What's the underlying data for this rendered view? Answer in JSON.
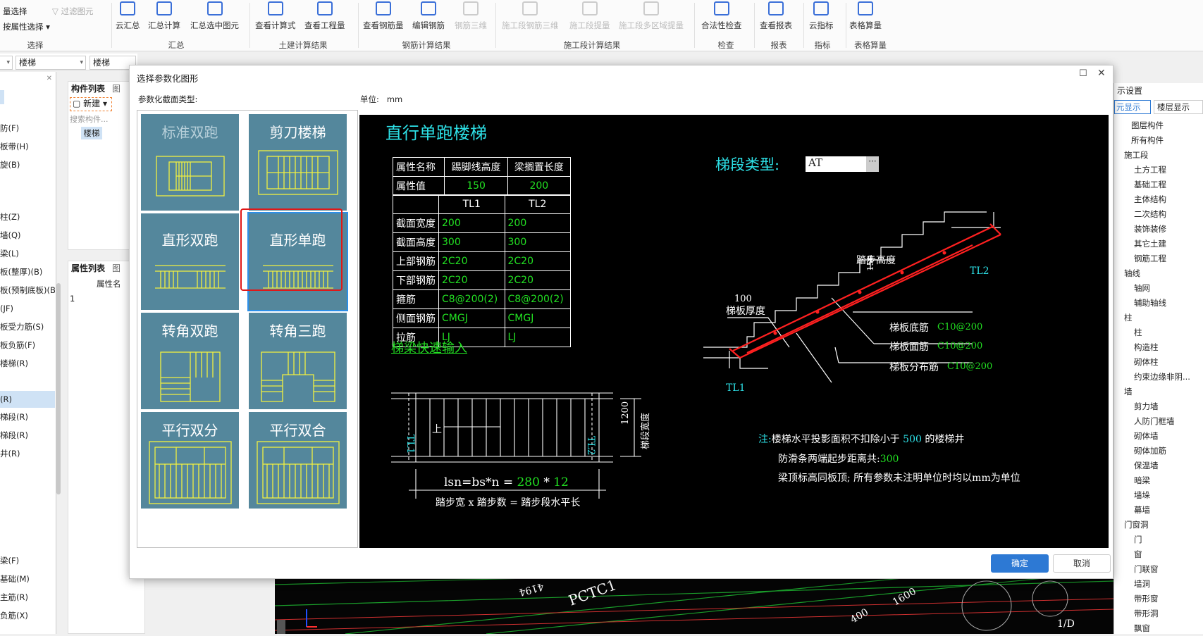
{
  "ribbon": {
    "select_group": {
      "label": "选择",
      "batch_select": "量选择",
      "filter": "过滤图元",
      "prop_select": "按属性选择"
    },
    "summary_group": {
      "label": "汇总",
      "cloud_summary": "云汇总",
      "summary_calc": "汇总计算",
      "summary_selected": "汇总选中图元"
    },
    "civil_group": {
      "label": "土建计算结果",
      "view_formula": "查看计算式",
      "view_quantity": "查看工程量"
    },
    "rebar_group": {
      "label": "钢筋计算结果",
      "view_rebar": "查看钢筋量",
      "edit_rebar": "编辑钢筋",
      "rebar_3d": "钢筋三维"
    },
    "construction_group": {
      "label": "施工段计算结果",
      "seg_rebar_3d": "施工段钢筋三维",
      "seg_extract": "施工段提量",
      "seg_multi_extract": "施工段多区域提量"
    },
    "check_group": {
      "label": "检查",
      "legality_check": "合法性检查"
    },
    "report_group": {
      "label": "报表",
      "view_report": "查看报表"
    },
    "index_group": {
      "label": "指标",
      "cloud_index": "云指标"
    },
    "table_group": {
      "label": "表格算量",
      "table_calc": "表格算量"
    }
  },
  "filterbar": {
    "combo1": "楼梯",
    "combo2": "楼梯"
  },
  "nav_items": [
    "防(F)",
    "板带(H)",
    "旋(B)",
    "柱(Z)",
    "墙(Q)",
    "梁(L)",
    "板(整厚)(B)",
    "板(预制底板)(B)",
    "(JF)",
    "板受力筋(S)",
    "板负筋(F)",
    "楼梯(R)",
    "(R)",
    "梯段(R)",
    "梯段(R)",
    "井(R)",
    "梁(F)",
    "基础(M)",
    "主筋(R)",
    "负筋(X)"
  ],
  "component_list": {
    "tab1": "构件列表",
    "tab2": "图",
    "new_button": "新建",
    "search_placeholder": "搜索构件...",
    "item": "楼梯"
  },
  "property_list": {
    "tab1": "属性列表",
    "tab2": "图",
    "col_name": "属性名",
    "row1": "1"
  },
  "right_panel": {
    "header": "示设置",
    "tab1": "元显示",
    "tab2": "楼层显示",
    "items": [
      "图层构件",
      "所有构件",
      "施工段",
      "土方工程",
      "基础工程",
      "主体结构",
      "二次结构",
      "装饰装修",
      "其它土建",
      "钢筋工程",
      "轴线",
      "轴网",
      "辅助轴线",
      "柱",
      "柱",
      "构造柱",
      "砌体柱",
      "约束边缘非阴...",
      "墙",
      "剪力墙",
      "人防门框墙",
      "砌体墙",
      "砌体加筋",
      "保温墙",
      "暗梁",
      "墙垛",
      "幕墙",
      "门窗洞",
      "门",
      "窗",
      "门联窗",
      "墙洞",
      "带形窗",
      "带形洞",
      "飘窗"
    ]
  },
  "viewport_labels": {
    "lbl1": "PCTC1",
    "lbl2": "400",
    "lbl3": "1600",
    "lbl4": "1/D",
    "lbl5": "4194"
  },
  "dialog": {
    "title": "选择参数化图形",
    "section_type_label": "参数化截面类型:",
    "unit_label": "单位:",
    "unit_value": "mm",
    "shapes": [
      "标准双跑",
      "剪刀楼梯",
      "直形双跑",
      "直形单跑",
      "转角双跑",
      "转角三跑",
      "平行双分",
      "平行双合"
    ],
    "selected_shape": "直形单跑",
    "ok_button": "确定",
    "cancel_button": "取消"
  },
  "cad": {
    "title": "直行单跑楼梯",
    "attr_table": {
      "h1": "属性名称",
      "h2": "踢脚线高度",
      "h3": "梁搁置长度",
      "r1": "属性值",
      "v1": "150",
      "v2": "200"
    },
    "beam_table": {
      "col1": "TL1",
      "col2": "TL2",
      "rows": [
        {
          "name": "截面宽度",
          "tl1": "200",
          "tl2": "200"
        },
        {
          "name": "截面高度",
          "tl1": "300",
          "tl2": "300"
        },
        {
          "name": "上部钢筋",
          "tl1": "2C20",
          "tl2": "2C20"
        },
        {
          "name": "下部钢筋",
          "tl1": "2C20",
          "tl2": "2C20"
        },
        {
          "name": "箍筋",
          "tl1": "C8@200(2)",
          "tl2": "C8@200(2)"
        },
        {
          "name": "侧面钢筋",
          "tl1": "CMGJ",
          "tl2": "CMGJ"
        },
        {
          "name": "拉筋",
          "tl1": "LJ",
          "tl2": "LJ"
        }
      ]
    },
    "quick_input": "梯梁快速输入",
    "segment_type_label": "梯段类型:",
    "segment_type_value": "AT",
    "step_height_label": "踏步高度",
    "step_height_value": "150",
    "thickness_value": "100",
    "thickness_label": "梯板厚度",
    "tl1": "TL1",
    "tl2": "TL2",
    "bottom_rebar_label": "梯板底筋",
    "bottom_rebar_value": "C10@200",
    "top_rebar_label": "梯板面筋",
    "top_rebar_value": "C10@200",
    "dist_rebar_label": "梯板分布筋",
    "dist_rebar_value": "C10@200",
    "note_prefix": "注:",
    "note1_a": "楼梯水平投影面积不扣除小于",
    "note1_val": "500",
    "note1_b": "的楼梯井",
    "note2_a": "防滑条两端起步距离共:",
    "note2_val": "300",
    "note3": "梁顶标高同板顶; 所有参数未注明单位时均以mm为单位",
    "plan_tl1": "TL1",
    "plan_tl2": "TL2",
    "plan_up": "上",
    "plan_width_value": "1200",
    "plan_width_label": "梯段宽度",
    "formula_a": "lsn=bs*n =",
    "formula_bs": "280",
    "formula_mul": "*",
    "formula_n": "12",
    "formula_caption": "踏步宽 x 踏步数 = 踏步段水平长"
  },
  "colors": {
    "cad_cyan": "#2de0e6",
    "cad_green": "#22e022",
    "cad_red": "#ff2020",
    "cell_bg": "#54879c",
    "ok_blue": "#2d79d4"
  }
}
